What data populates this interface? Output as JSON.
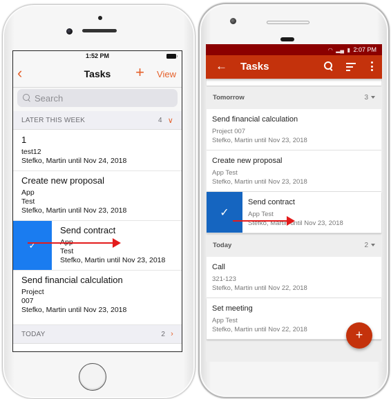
{
  "ios": {
    "status_time": "1:52 PM",
    "nav": {
      "back_icon": "chevron-left-icon",
      "title": "Tasks",
      "add_icon": "plus-icon",
      "view_label": "View"
    },
    "search": {
      "placeholder": "Search"
    },
    "sections": [
      {
        "label": "LATER THIS WEEK",
        "count": "4",
        "items": [
          {
            "title": "1",
            "lines": [
              "test12",
              "Stefko, Martin until Nov 24, 2018"
            ]
          },
          {
            "title": "Create new proposal",
            "lines": [
              "App",
              "Test",
              "Stefko, Martin until Nov 23, 2018"
            ]
          },
          {
            "title": "Send contract",
            "lines": [
              "App",
              "Test",
              "Stefko, Martin until Nov 23, 2018"
            ],
            "swiped": true
          },
          {
            "title": "Send financial calculation",
            "lines": [
              "Project",
              "007",
              "Stefko, Martin until Nov 23, 2018"
            ]
          }
        ]
      },
      {
        "label": "TODAY",
        "count": "2"
      }
    ]
  },
  "android": {
    "status_time": "2:07 PM",
    "toolbar": {
      "back_icon": "arrow-left-icon",
      "title": "Tasks",
      "search_icon": "search-icon",
      "sort_icon": "sort-icon",
      "more_icon": "more-vert-icon"
    },
    "sections": [
      {
        "label": "Tomorrow",
        "count": "3",
        "items": [
          {
            "title": "Send financial calculation",
            "subtitle": "Project 007",
            "meta": "Stefko, Martin until Nov 23, 2018"
          },
          {
            "title": "Create new proposal",
            "subtitle": "App Test",
            "meta": "Stefko, Martin until Nov 23, 2018"
          },
          {
            "title": "Send contract",
            "subtitle": "App Test",
            "meta": "Stefko, Martin until Nov 23, 2018",
            "swiped": true
          }
        ]
      },
      {
        "label": "Today",
        "count": "2",
        "items": [
          {
            "title": "Call",
            "subtitle": "321-123",
            "meta": "Stefko, Martin until Nov 22, 2018"
          },
          {
            "title": "Set meeting",
            "subtitle": "App Test",
            "meta": "Stefko, Martin until Nov 22, 2018"
          }
        ]
      }
    ],
    "fab_label": "+"
  },
  "colors": {
    "ios_accent": "#e5602a",
    "android_primary": "#c4320c",
    "android_status": "#8b0000",
    "swipe_ios": "#1a7cf0",
    "swipe_android": "#1565c0",
    "annotation_arrow": "#e31b1b"
  }
}
